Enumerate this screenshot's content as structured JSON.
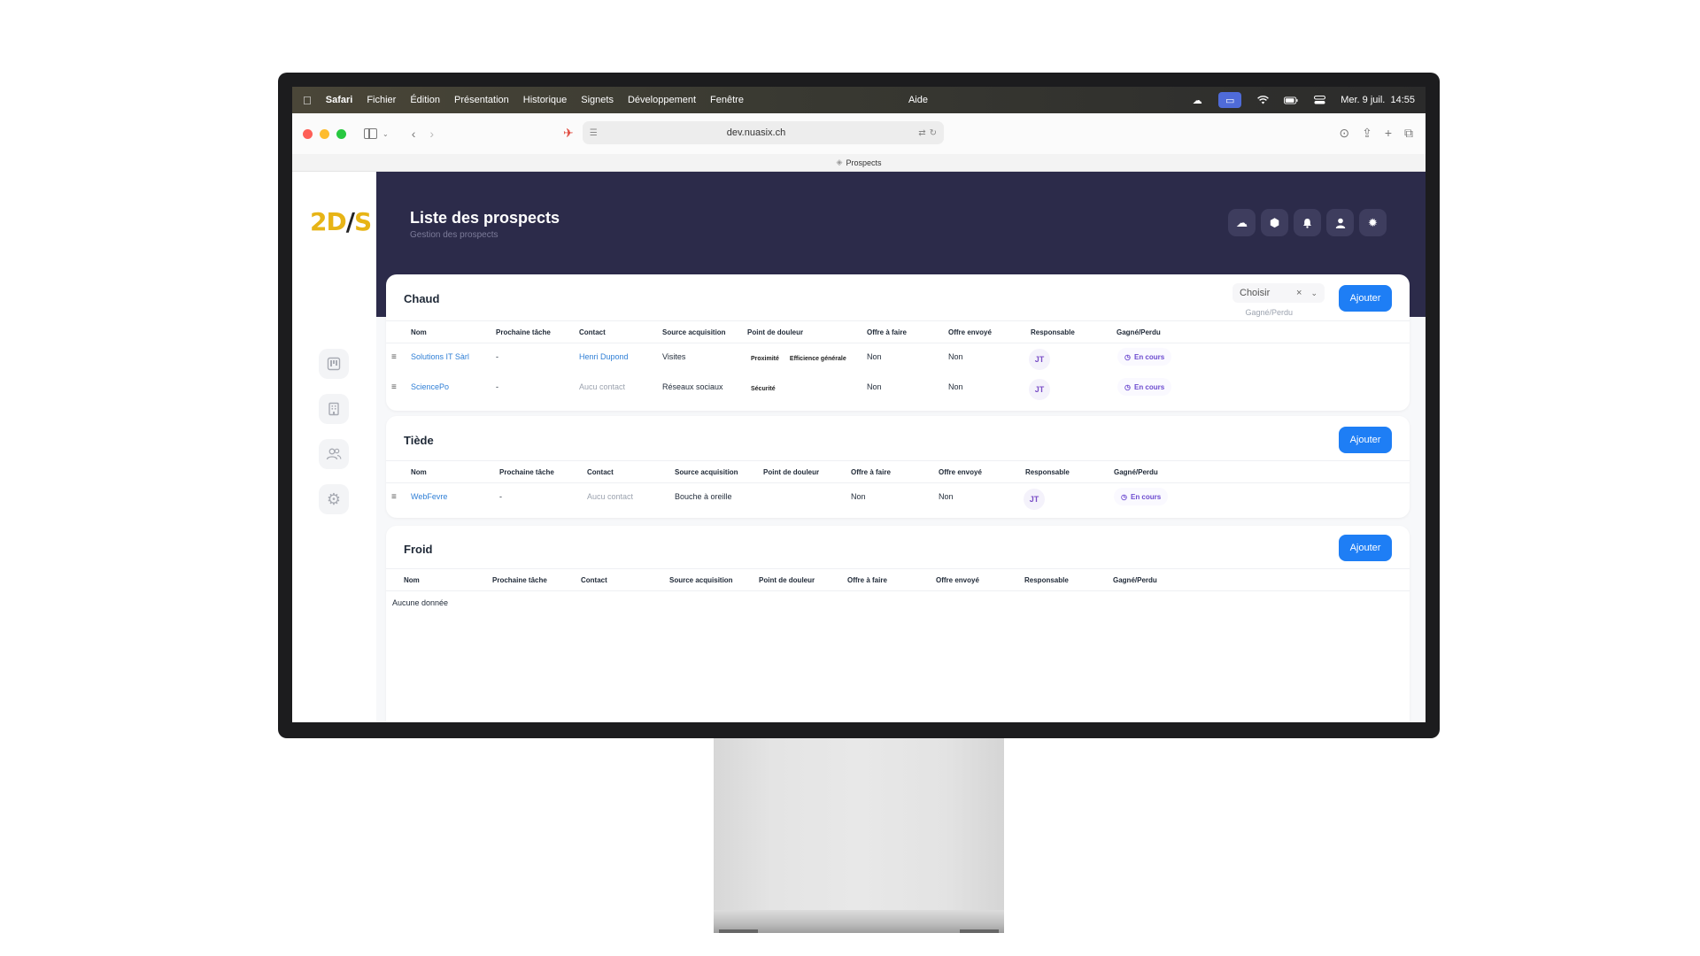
{
  "menubar": {
    "apple": "",
    "items": [
      "Safari",
      "Fichier",
      "Édition",
      "Présentation",
      "Historique",
      "Signets",
      "Développement",
      "Fenêtre"
    ],
    "help": "Aide",
    "clock": "Mer. 9 juil.  14:55"
  },
  "browser": {
    "url": "dev.nuasix.ch",
    "tab_title": "Prospects"
  },
  "app": {
    "logo": {
      "left": "2D",
      "slash": "/",
      "right": "S"
    },
    "page_title": "Liste des prospects",
    "page_subtitle": "Gestion des prospects",
    "nav_icons": [
      "kanban-icon",
      "building-icon",
      "users-icon",
      "settings-icon"
    ],
    "header_icons": [
      "cloud-upload-icon",
      "cube-icon",
      "bell-icon",
      "user-icon",
      "sun-icon"
    ]
  },
  "columns": [
    "Nom",
    "Prochaine tâche",
    "Contact",
    "Source acquisition",
    "Point de douleur",
    "Offre à faire",
    "Offre envoyé",
    "Responsable",
    "Gagné/Perdu"
  ],
  "sections": {
    "chaud": {
      "title": "Chaud",
      "add_label": "Ajouter",
      "filter": {
        "value": "Choisir",
        "clear": "×",
        "label": "Gagné/Perdu"
      },
      "rows": [
        {
          "nom": "Solutions IT Sàrl",
          "tache": "-",
          "contact": "Henri Dupond",
          "source": "Visites",
          "douleur": [
            "Proximité",
            "Efficience générale"
          ],
          "offre_faire": "Non",
          "offre_envoye": "Non",
          "responsable": "JT",
          "statut": "En cours"
        },
        {
          "nom": "SciencePo",
          "tache": "-",
          "contact": "Aucu contact",
          "source": "Réseaux sociaux",
          "douleur": [
            "Sécurité"
          ],
          "offre_faire": "Non",
          "offre_envoye": "Non",
          "responsable": "JT",
          "statut": "En cours"
        }
      ]
    },
    "tiede": {
      "title": "Tiède",
      "add_label": "Ajouter",
      "rows": [
        {
          "nom": "WebFevre",
          "tache": "-",
          "contact": "Aucu contact",
          "source": "Bouche à oreille",
          "offre_faire": "Non",
          "offre_envoye": "Non",
          "responsable": "JT",
          "statut": "En cours"
        }
      ]
    },
    "froid": {
      "title": "Froid",
      "add_label": "Ajouter",
      "empty": "Aucune donnée"
    }
  },
  "colors": {
    "accent": "#1e7ef5",
    "header": "#2c2b4a",
    "status": "#6d4bd0",
    "link": "#2f7fd6"
  }
}
